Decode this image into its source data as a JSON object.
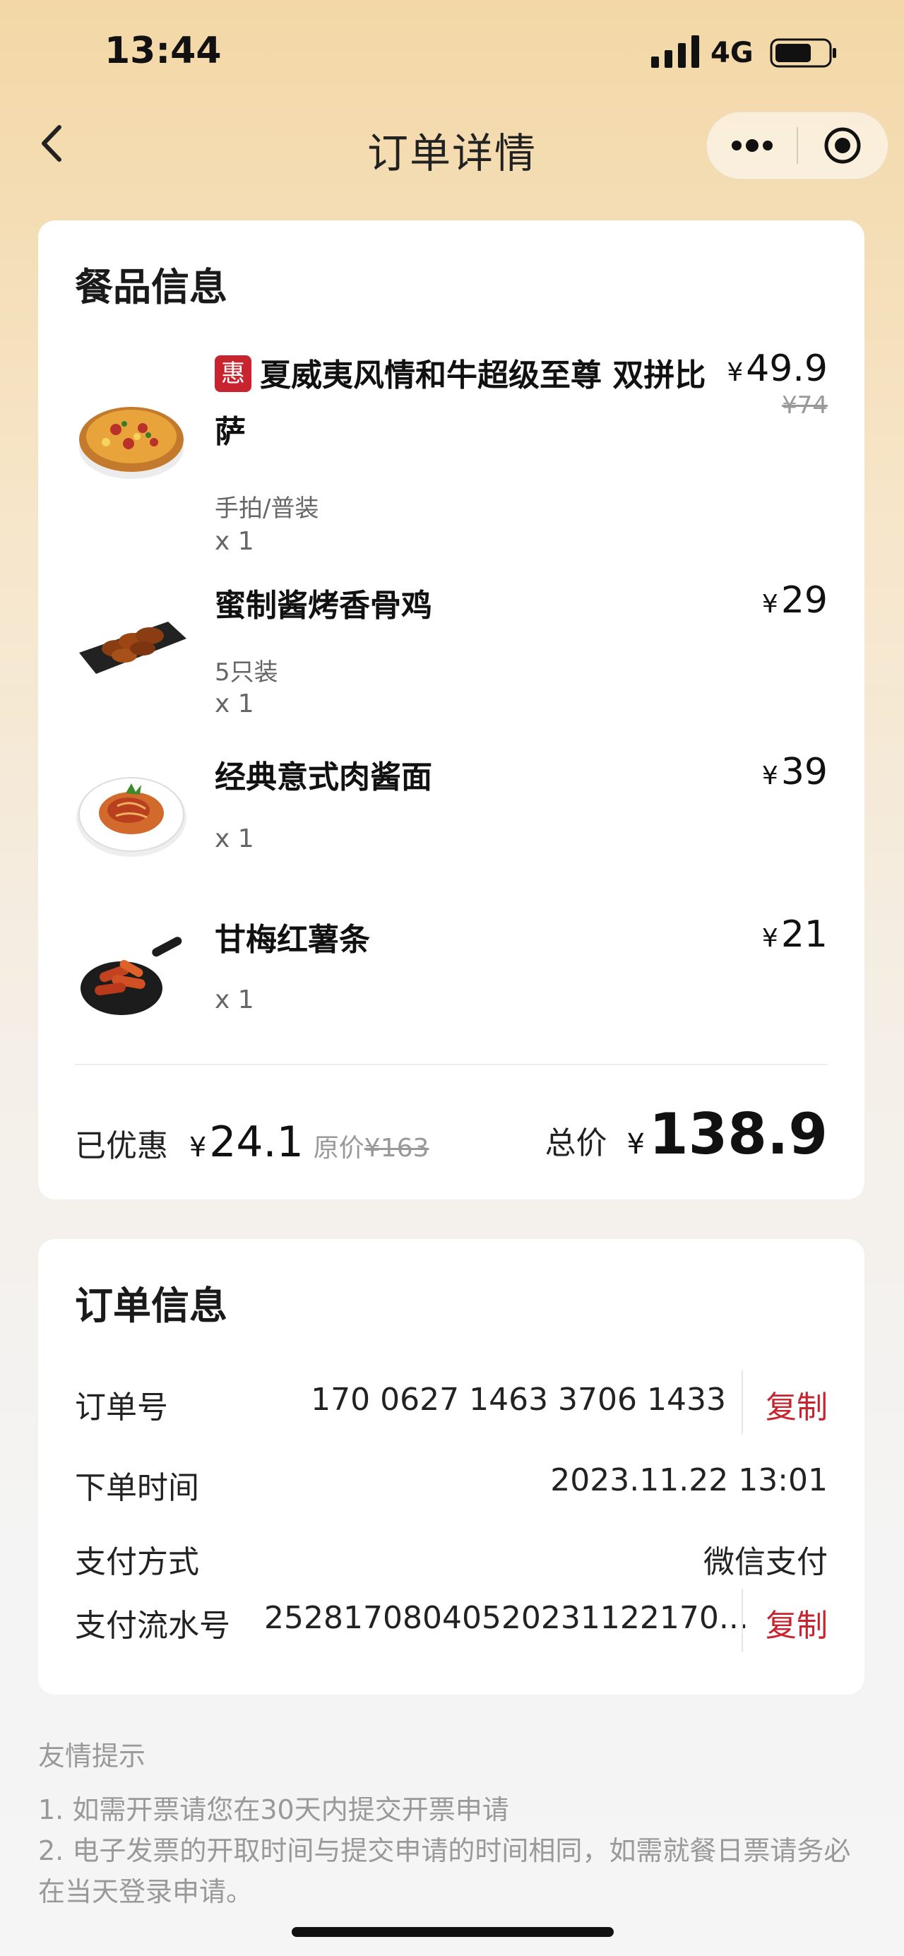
{
  "status_bar": {
    "time": "13:44",
    "network": "4G"
  },
  "nav": {
    "title": "订单详情"
  },
  "food_section": {
    "title": "餐品信息",
    "items": [
      {
        "badge": "惠",
        "name": "夏威夷风情和牛超级至尊 双拼比萨",
        "spec": "手拍/普装",
        "qty": "x 1",
        "currency": "¥",
        "price": "49.9",
        "original_price": "¥74",
        "thumb_icon": "pizza-image"
      },
      {
        "name": "蜜制酱烤香骨鸡",
        "spec": "5只装",
        "qty": "x 1",
        "currency": "¥",
        "price": "29",
        "thumb_icon": "chicken-wings-image"
      },
      {
        "name": "经典意式肉酱面",
        "qty": "x 1",
        "currency": "¥",
        "price": "39",
        "thumb_icon": "spaghetti-image"
      },
      {
        "name": "甘梅红薯条",
        "qty": "x 1",
        "currency": "¥",
        "price": "21",
        "thumb_icon": "sweet-potato-fries-image"
      }
    ],
    "summary": {
      "discount_label": "已优惠",
      "discount_currency": "¥",
      "discount_amount": "24.1",
      "original_label": "原价",
      "original_amount": "¥163",
      "total_label": "总价",
      "total_currency": "¥",
      "total_amount": "138.9"
    }
  },
  "order_section": {
    "title": "订单信息",
    "order_no": {
      "label": "订单号",
      "value": "170 0627 1463 3706 1433",
      "action": "复制"
    },
    "order_time": {
      "label": "下单时间",
      "value": "2023.11.22 13:01"
    },
    "pay_method": {
      "label": "支付方式",
      "value": "微信支付"
    },
    "pay_serial": {
      "label": "支付流水号",
      "value": "25281708040520231122170...",
      "action": "复制"
    }
  },
  "tips": {
    "title": "友情提示",
    "lines": [
      "1. 如需开票请您在30天内提交开票申请",
      "2. 电子发票的开取时间与提交申请的时间相同，如需就餐日票请务必在当天登录申请。"
    ]
  },
  "colors": {
    "accent": "#c8242f",
    "bg_top": "#f3d7a6"
  }
}
